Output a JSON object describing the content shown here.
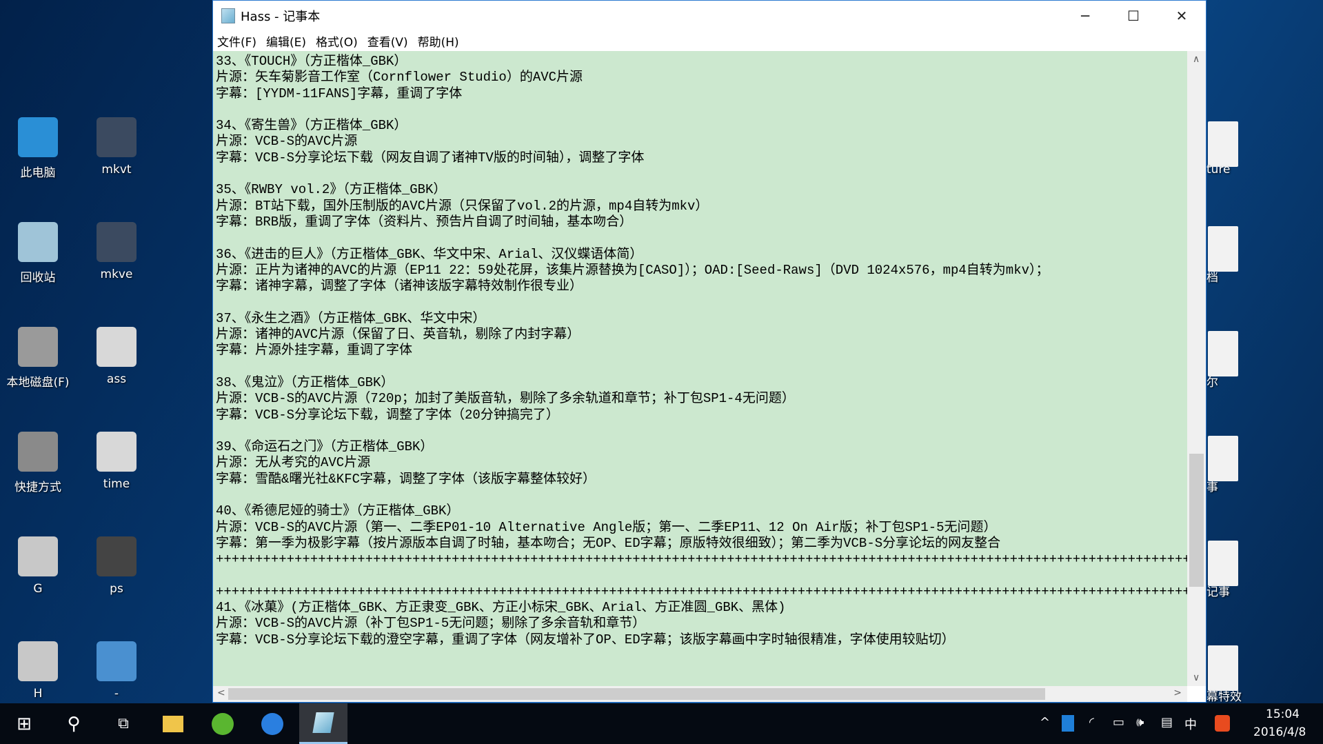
{
  "desktop": {
    "left_icons": [
      {
        "label": "此电脑",
        "color": "#2a8fd6"
      },
      {
        "label": "mkvt",
        "color": "#3b4a60"
      },
      {
        "label": "回收站",
        "color": "#9fc4d8"
      },
      {
        "label": "mkve",
        "color": "#3b4a60"
      },
      {
        "label": "本地磁盘(F)",
        "color": "#9a9a9a"
      },
      {
        "label": "ass",
        "color": "#d8d8d8"
      },
      {
        "label": "快捷方式",
        "color": "#8a8a8a"
      },
      {
        "label": "time",
        "color": "#d8d8d8"
      },
      {
        "label": "G",
        "color": "#c8c8c8"
      },
      {
        "label": "ps",
        "color": "#444444"
      },
      {
        "label": "H",
        "color": "#c8c8c8"
      },
      {
        "label": "-",
        "color": "#4a90d0"
      }
    ],
    "right_icons": [
      "ture",
      "档",
      "尔",
      "事",
      "记事",
      "幕特效"
    ]
  },
  "window": {
    "title": "Hass - 记事本",
    "controls": {
      "minimize": "─",
      "maximize": "☐",
      "close": "✕"
    },
    "menu": [
      "文件(F)",
      "编辑(E)",
      "格式(O)",
      "查看(V)",
      "帮助(H)"
    ],
    "background_color": "#cce8cf",
    "lines": [
      "33、《TOUCH》（方正楷体_GBK）",
      "片源：矢车菊影音工作室（Cornflower Studio）的AVC片源",
      "字幕：[YYDM-11FANS]字幕，重调了字体",
      "",
      "34、《寄生兽》（方正楷体_GBK）",
      "片源：VCB-S的AVC片源",
      "字幕：VCB-S分享论坛下载（网友自调了诸神TV版的时间轴），调整了字体",
      "",
      "35、《RWBY vol.2》（方正楷体_GBK）",
      "片源：BT站下载，国外压制版的AVC片源（只保留了vol.2的片源，mp4自转为mkv）",
      "字幕：BRB版，重调了字体（资料片、预告片自调了时间轴，基本吻合）",
      "",
      "36、《进击的巨人》（方正楷体_GBK、华文中宋、Arial、汉仪蝶语体简）",
      "片源：正片为诸神的AVC的片源（EP11 22：59处花屏，该集片源替换为[CASO]）；OAD:[Seed-Raws]（DVD 1024x576，mp4自转为mkv）；",
      "字幕：诸神字幕，调整了字体（诸神该版字幕特效制作很专业）",
      "",
      "37、《永生之酒》（方正楷体_GBK、华文中宋）",
      "片源：诸神的AVC片源（保留了日、英音轨，剔除了内封字幕）",
      "字幕：片源外挂字幕，重调了字体",
      "",
      "38、《鬼泣》（方正楷体_GBK）",
      "片源：VCB-S的AVC片源（720p；加封了美版音轨，剔除了多余轨道和章节；补丁包SP1-4无问题）",
      "字幕：VCB-S分享论坛下载，调整了字体（20分钟搞完了）",
      "",
      "39、《命运石之门》（方正楷体_GBK）",
      "片源：无从考究的AVC片源",
      "字幕：雪酷&曙光社&KFC字幕，调整了字体（该版字幕整体较好）",
      "",
      "40、《希德尼娅的骑士》（方正楷体_GBK）",
      "片源：VCB-S的AVC片源（第一、二季EP01-10 Alternative Angle版；第一、二季EP11、12 On Air版；补丁包SP1-5无问题）",
      "字幕：第一季为极影字幕（按片源版本自调了时轴，基本吻合；无OP、ED字幕；原版特效很细致）；第二季为VCB-S分享论坛的网友整合",
      "++++++++++++++++++++++++++++++++++++++++++++++++++++++++++++++++++++++++++++++++++++++++++++++++++++++++++++++++++++++++++++++++++++++",
      "",
      "++++++++++++++++++++++++++++++++++++++++++++++++++++++++++++++++++++++++++++++++++++++++++++++++++++++++++++++++++++++++++++++++++++++",
      "41、《冰菓》(方正楷体_GBK、方正隶变_GBK、方正小标宋_GBK、Arial、方正准圆_GBK、黑体)",
      "片源：VCB-S的AVC片源（补丁包SP1-5无问题；剔除了多余音轨和章节）",
      "字幕：VCB-S分享论坛下载的澄空字幕，重调了字体（网友增补了OP、ED字幕；该版字幕画中字时轴很精准，字体使用较贴切）"
    ],
    "vertical_scroll_fraction": 0.82,
    "horizontal_scroll_fraction": 0.0
  },
  "taskbar": {
    "apps": [
      "start-icon",
      "search-icon",
      "task-view-icon",
      "file-explorer-icon",
      "browser-icon",
      "sogou-browser-icon",
      "notepad-icon"
    ],
    "tray": {
      "chevron": "^",
      "ime": "中",
      "time": "15:04",
      "date": "2016/4/8"
    }
  }
}
